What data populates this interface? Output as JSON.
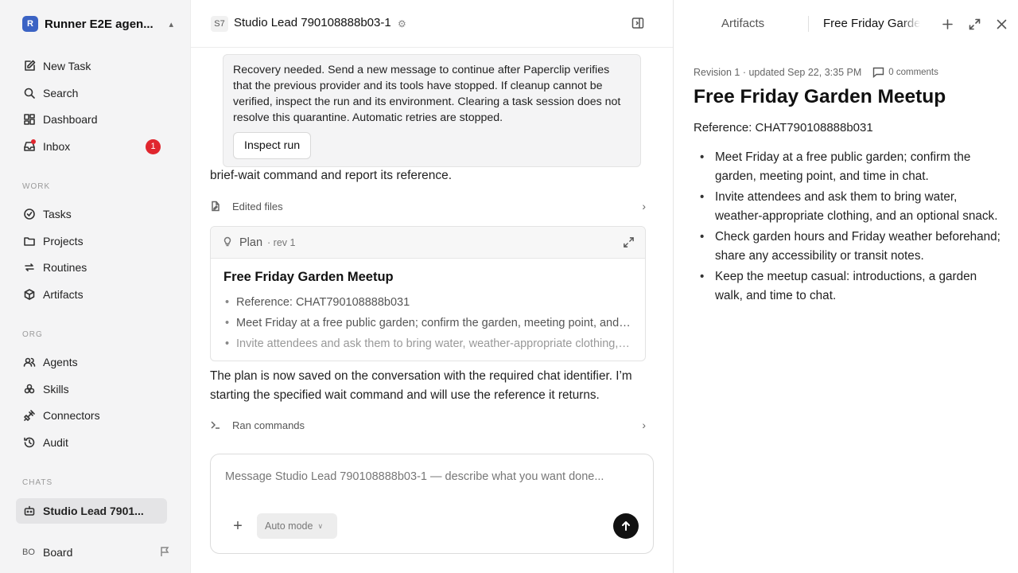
{
  "sidebar": {
    "workspace_logo": "R",
    "workspace_name": "Runner E2E agen...",
    "nav": [
      {
        "label": "New Task",
        "icon": "edit-icon"
      },
      {
        "label": "Search",
        "icon": "search-icon"
      },
      {
        "label": "Dashboard",
        "icon": "dashboard-icon"
      },
      {
        "label": "Inbox",
        "icon": "inbox-icon",
        "badge": "1"
      }
    ],
    "work_title": "WORK",
    "work": [
      {
        "label": "Tasks",
        "icon": "check-circle-icon"
      },
      {
        "label": "Projects",
        "icon": "folder-icon"
      },
      {
        "label": "Routines",
        "icon": "repeat-icon"
      },
      {
        "label": "Artifacts",
        "icon": "box-icon"
      }
    ],
    "org_title": "ORG",
    "org": [
      {
        "label": "Agents",
        "icon": "users-icon"
      },
      {
        "label": "Skills",
        "icon": "skills-icon"
      },
      {
        "label": "Connectors",
        "icon": "plug-icon"
      },
      {
        "label": "Audit",
        "icon": "history-icon"
      }
    ],
    "chats_title": "CHATS",
    "chats": [
      {
        "label": "Studio Lead 7901...",
        "icon": "bot-icon"
      }
    ],
    "board": {
      "avatar": "BO",
      "label": "Board"
    }
  },
  "main": {
    "agent_chip": "S7",
    "title": "Studio Lead 790108888b03-1",
    "recovery": {
      "text": "Recovery needed. Send a new message to continue after Paperclip verifies that the previous provider and its tools have stopped. If cleanup cannot be verified, inspect the run and its environment. Clearing a task session does not resolve this quarantine. Automatic retries are stopped.",
      "button": "Inspect run"
    },
    "partial_line": "brief-wait command and report its reference.",
    "edited_files": "Edited files",
    "plan": {
      "label": "Plan",
      "rev": "· rev 1",
      "title": "Free Friday Garden Meetup",
      "items": [
        "Reference: CHAT790108888b031",
        "Meet Friday at a free public garden; confirm the garden, meeting point, and time in chat.",
        "Invite attendees and ask them to bring water, weather-appropriate clothing, and an optional snack."
      ]
    },
    "message": "The plan is now saved on the conversation with the required chat identifier. I’m starting the specified wait command and will use the reference it returns.",
    "ran_commands": "Ran commands",
    "composer": {
      "placeholder": "Message Studio Lead 790108888b03-1 — describe what you want done...",
      "mode": "Auto mode"
    }
  },
  "artifact": {
    "tab_artifacts": "Artifacts",
    "tab_file": "Free Friday Garden Meetup",
    "meta": "Revision 1 · updated Sep 22, 3:35 PM",
    "comments": "0 comments",
    "title": "Free Friday Garden Meetup",
    "reference": "Reference: CHAT790108888b031",
    "items": [
      "Meet Friday at a free public garden; confirm the garden, meeting point, and time in chat.",
      "Invite attendees and ask them to bring water, weather-appropriate clothing, and an optional snack.",
      "Check garden hours and Friday weather beforehand; share any accessibility or transit notes.",
      "Keep the meetup casual: introductions, a garden walk, and time to chat."
    ]
  },
  "colors": {
    "badge": "#e0262e",
    "workspace_logo": "#3b63c4",
    "send_button": "#111111"
  }
}
